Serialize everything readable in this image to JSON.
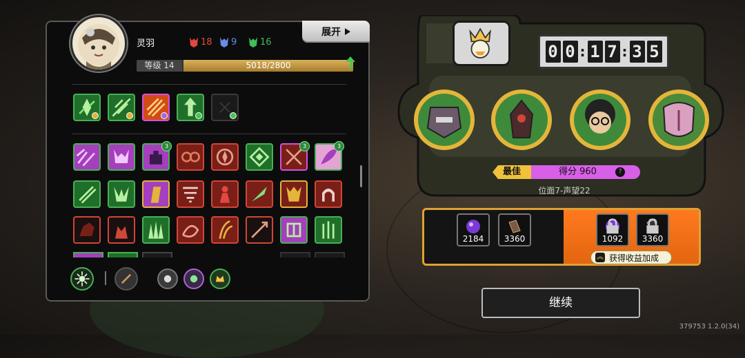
{
  "player": {
    "name": "灵羽",
    "level_label": "等级 14",
    "xp_text": "5018/2800"
  },
  "resources": [
    {
      "name": "red-mask",
      "value": "18",
      "color": "#e2483f"
    },
    {
      "name": "blue-mask",
      "value": "9",
      "color": "#6a8ce8"
    },
    {
      "name": "green-mask",
      "value": "16",
      "color": "#3fbf55"
    }
  ],
  "header": {
    "expand_label": "展开",
    "expand_icon": "play-right-icon"
  },
  "timer": {
    "digits": [
      "0",
      "0",
      "1",
      "7",
      "3",
      "5"
    ]
  },
  "score": {
    "best_label": "最佳",
    "score_text": "得分 960",
    "help": "?",
    "rank_text": "位面7-声望22"
  },
  "rewards": {
    "base": [
      {
        "icon": "purple-orb-icon",
        "value": "2184"
      },
      {
        "icon": "book-icon",
        "value": "3360"
      }
    ],
    "bonus": [
      {
        "icon": "purple-orb-icon",
        "value": "1092"
      },
      {
        "icon": "book-icon",
        "value": "3360"
      }
    ],
    "bonus_label": "获得收益加成"
  },
  "continue_label": "继续",
  "version": "379753 1.2.0(34)",
  "colors": {
    "accent_gold": "#e5b53a",
    "score_pink": "#d85fe8",
    "bonus_orange": "#ff7a1e"
  },
  "skill_badges": [
    "3",
    "3",
    "3"
  ]
}
